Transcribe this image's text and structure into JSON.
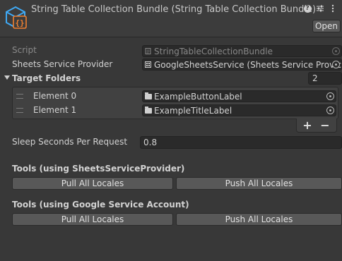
{
  "header": {
    "title": "String Table Collection Bundle (String Table Collection Bundle)",
    "open_label": "Open",
    "icons": [
      "help-icon",
      "preset-sliders-icon",
      "kebab-menu-icon"
    ]
  },
  "fields": {
    "script_label": "Script",
    "script_value": "StringTableCollectionBundle",
    "sheets_provider_label": "Sheets Service Provider",
    "sheets_provider_value": "GoogleSheetsService (Sheets Service Provic"
  },
  "target_folders": {
    "label": "Target Folders",
    "count": "2",
    "elements": [
      {
        "label": "Element 0",
        "value": "ExampleButtonLabel"
      },
      {
        "label": "Element 1",
        "value": "ExampleTitleLabel"
      }
    ],
    "add_label": "+",
    "remove_label": "−"
  },
  "sleep": {
    "label": "Sleep Seconds Per Request",
    "value": "0.8"
  },
  "tools_provider": {
    "heading": "Tools (using SheetsServiceProvider)",
    "pull_label": "Pull All Locales",
    "push_label": "Push All Locales"
  },
  "tools_account": {
    "heading": "Tools (using Google Service Account)",
    "pull_label": "Pull All Locales",
    "push_label": "Push All Locales"
  },
  "colors": {
    "background": "#383838",
    "header": "#3c3c3c",
    "field": "#2a2a2a",
    "button": "#585858",
    "logo_blue": "#3fa9f5",
    "logo_orange": "#f08030"
  }
}
